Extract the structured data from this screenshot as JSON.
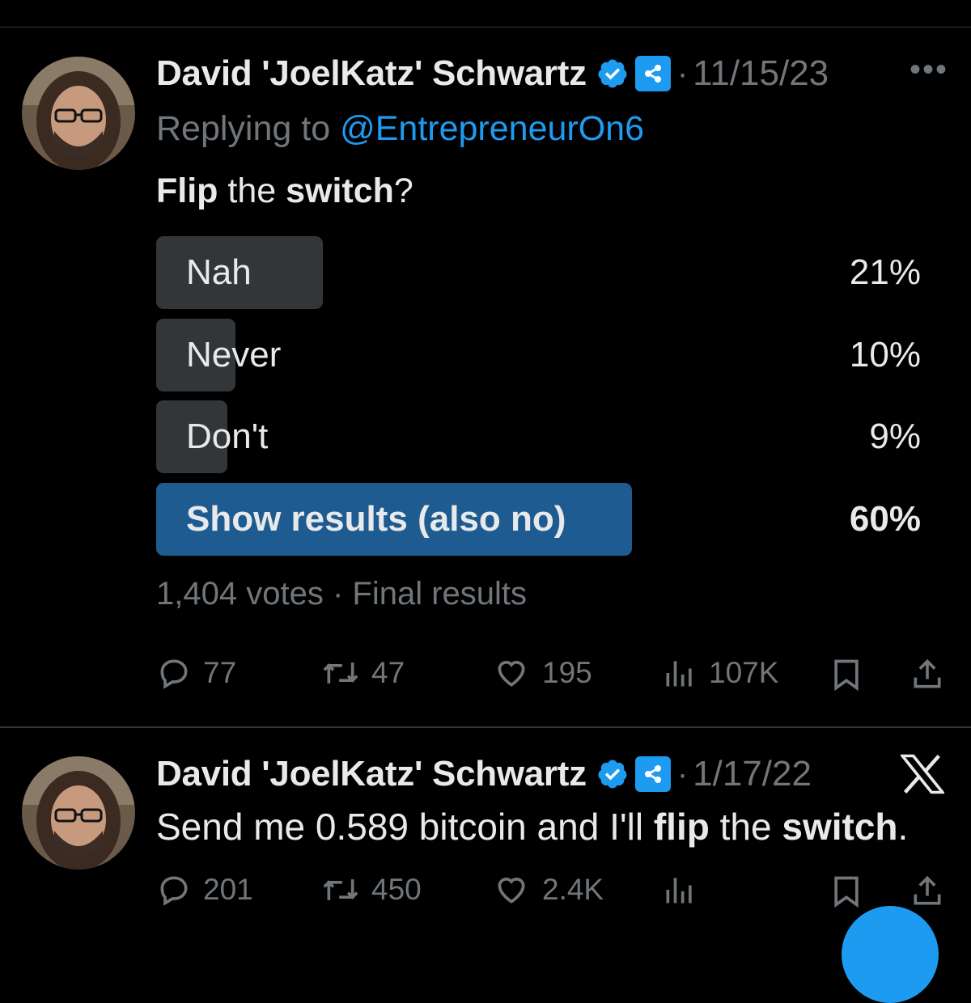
{
  "tweets": [
    {
      "author_name": "David 'JoelKatz' Schwartz",
      "date": "11/15/23",
      "separator": "·",
      "more_label": "•••",
      "reply_prefix": "Replying to",
      "reply_handle": "@EntrepreneurOn6",
      "text_parts": [
        "Flip",
        " the ",
        "switch",
        "?"
      ],
      "poll": {
        "options": [
          {
            "label": "Nah",
            "percent_label": "21%",
            "percent": 21,
            "winner": false
          },
          {
            "label": "Never",
            "percent_label": "10%",
            "percent": 10,
            "winner": false
          },
          {
            "label": "Don't",
            "percent_label": "9%",
            "percent": 9,
            "winner": false
          },
          {
            "label": "Show results (also no)",
            "percent_label": "60%",
            "percent": 60,
            "winner": true
          }
        ],
        "votes": "1,404 votes",
        "status": "Final results"
      },
      "stats": {
        "replies": "77",
        "reposts": "47",
        "likes": "195",
        "views": "107K"
      }
    },
    {
      "author_name": "David 'JoelKatz' Schwartz",
      "date": "1/17/22",
      "separator": "·",
      "text_parts": [
        "Send me 0.589 bitcoin and I'll ",
        "flip",
        " the ",
        "switch",
        "."
      ],
      "stats": {
        "replies": "201",
        "reposts": "450",
        "likes": "2.4K",
        "views": ""
      }
    }
  ],
  "icons": {
    "verified": "verified-badge-icon",
    "affiliate": "ripple-logo-icon",
    "reply": "reply-icon",
    "repost": "repost-icon",
    "like": "heart-icon",
    "views": "views-icon",
    "bookmark": "bookmark-icon",
    "share": "share-icon",
    "platform": "x-logo-icon"
  },
  "colors": {
    "background": "#000000",
    "text": "#e7e9ea",
    "muted": "#71767b",
    "accent": "#1d9bf0",
    "poll_bar": "#333639",
    "poll_winner": "#1e5b91"
  }
}
